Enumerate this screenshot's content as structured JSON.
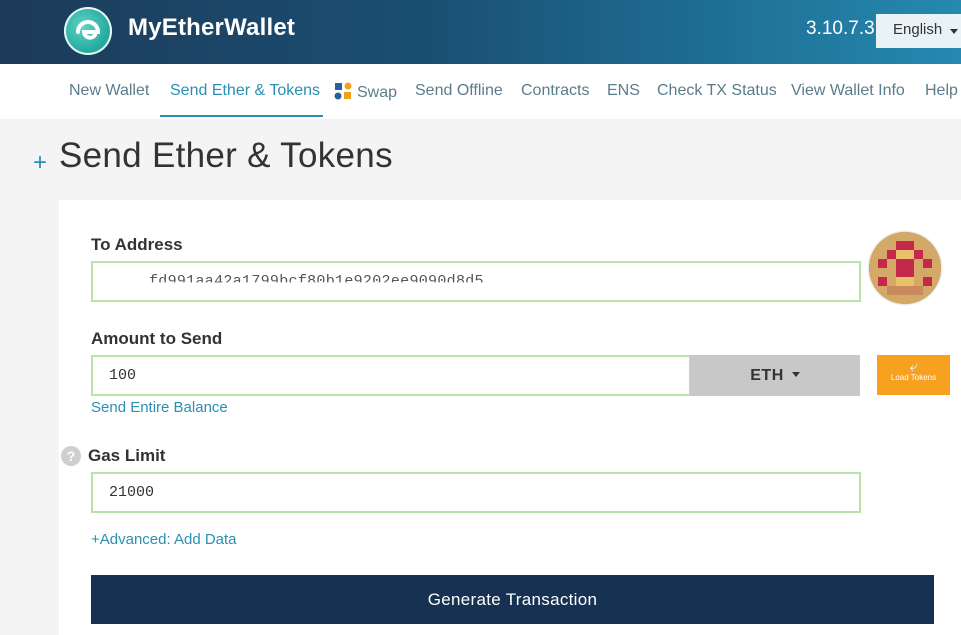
{
  "header": {
    "brand": "MyEtherWallet",
    "version": "3.10.7.3",
    "language": "English"
  },
  "nav": {
    "items": [
      {
        "label": "New Wallet"
      },
      {
        "label": "Send Ether & Tokens",
        "active": true
      },
      {
        "label": "Swap"
      },
      {
        "label": "Send Offline"
      },
      {
        "label": "Contracts"
      },
      {
        "label": "ENS"
      },
      {
        "label": "Check TX Status"
      },
      {
        "label": "View Wallet Info"
      },
      {
        "label": "Help"
      }
    ]
  },
  "page": {
    "title": "Send Ether & Tokens"
  },
  "form": {
    "to_address_label": "To Address",
    "to_address_value": "fd991aa42a1799bcf80b1e9202ee9090d8d5",
    "amount_label": "Amount to Send",
    "amount_value": "100",
    "currency": "ETH",
    "load_tokens_label": "Load Tokens",
    "send_entire_balance": "Send Entire Balance",
    "gas_limit_label": "Gas Limit",
    "gas_limit_value": "21000",
    "advanced_link": "+Advanced: Add Data",
    "generate_button": "Generate Transaction"
  },
  "colors": {
    "header_dark": "#1d3b5a",
    "accent": "#2b8fb3",
    "input_border": "#b5e3a8",
    "button_primary": "#163151",
    "load_tokens": "#f8a020"
  }
}
